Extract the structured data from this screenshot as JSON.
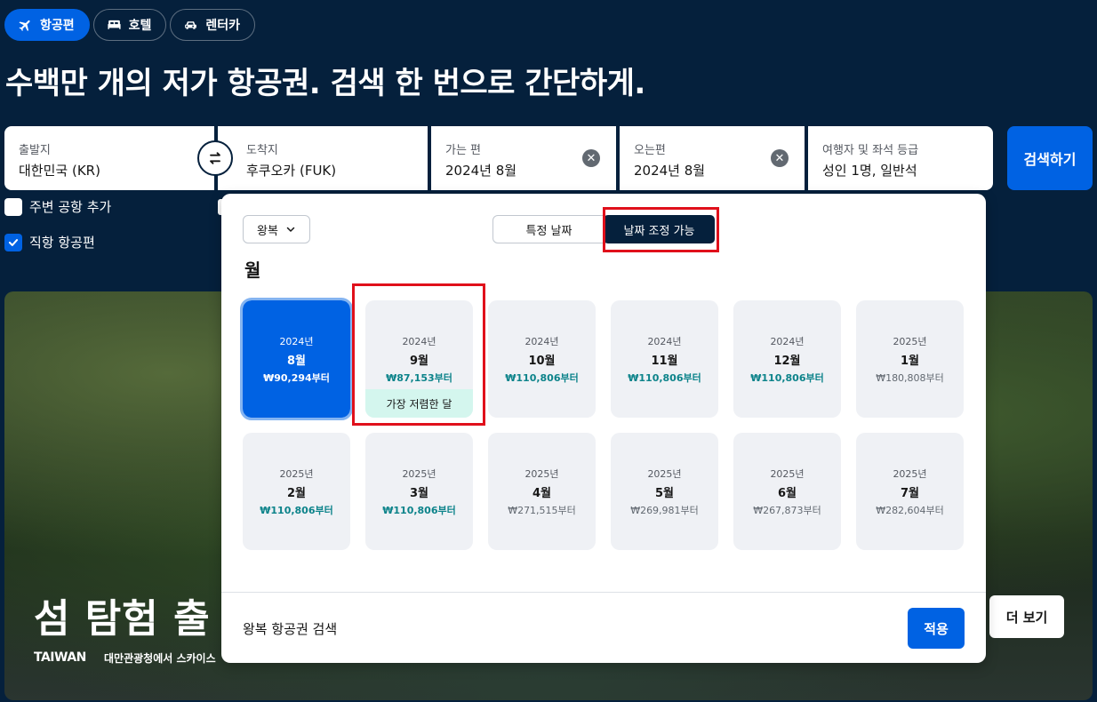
{
  "tabs": [
    {
      "label": "항공편",
      "icon": "airplane-icon"
    },
    {
      "label": "호텔",
      "icon": "bed-icon"
    },
    {
      "label": "렌터카",
      "icon": "car-icon"
    }
  ],
  "headline": "수백만 개의 저가 항공권. 검색 한 번으로 간단하게.",
  "search": {
    "origin": {
      "label": "출발지",
      "value": "대한민국 (KR)"
    },
    "destination": {
      "label": "도착지",
      "value": "후쿠오카 (FUK)"
    },
    "depart": {
      "label": "가는 편",
      "value": "2024년 8월"
    },
    "return": {
      "label": "오는편",
      "value": "2024년 8월"
    },
    "travellers": {
      "label": "여행자 및 좌석 등급",
      "value": "성인 1명, 일반석"
    },
    "search_button": "검색하기"
  },
  "options": {
    "nearby": "주변 공항 추가",
    "direct": "직항 항공편"
  },
  "popup": {
    "trip_type": "왕복",
    "toggle_specific": "특정 날짜",
    "toggle_flexible": "날짜 조정 가능",
    "heading": "월",
    "cheapest_badge": "가장 저렴한 달",
    "months": [
      {
        "year": "2024년",
        "month": "8월",
        "price": "₩90,294부터"
      },
      {
        "year": "2024년",
        "month": "9월",
        "price": "₩87,153부터"
      },
      {
        "year": "2024년",
        "month": "10월",
        "price": "₩110,806부터"
      },
      {
        "year": "2024년",
        "month": "11월",
        "price": "₩110,806부터"
      },
      {
        "year": "2024년",
        "month": "12월",
        "price": "₩110,806부터"
      },
      {
        "year": "2025년",
        "month": "1월",
        "price": "₩180,808부터"
      },
      {
        "year": "2025년",
        "month": "2월",
        "price": "₩110,806부터"
      },
      {
        "year": "2025년",
        "month": "3월",
        "price": "₩110,806부터"
      },
      {
        "year": "2025년",
        "month": "4월",
        "price": "₩271,515부터"
      },
      {
        "year": "2025년",
        "month": "5월",
        "price": "₩269,981부터"
      },
      {
        "year": "2025년",
        "month": "6월",
        "price": "₩267,873부터"
      },
      {
        "year": "2025년",
        "month": "7월",
        "price": "₩282,604부터"
      }
    ],
    "footer_label": "왕복 항공권 검색",
    "apply_button": "적용"
  },
  "hero": {
    "title": "섬 탐험 출",
    "logo": "TAIWAN",
    "caption": "대만관광청에서 스카이스",
    "more_button": "더 보기"
  },
  "colors": {
    "brand_navy": "#05203c",
    "brand_blue": "#0062e3",
    "deal_teal": "#0c838a",
    "highlight_red": "#e0101b"
  }
}
